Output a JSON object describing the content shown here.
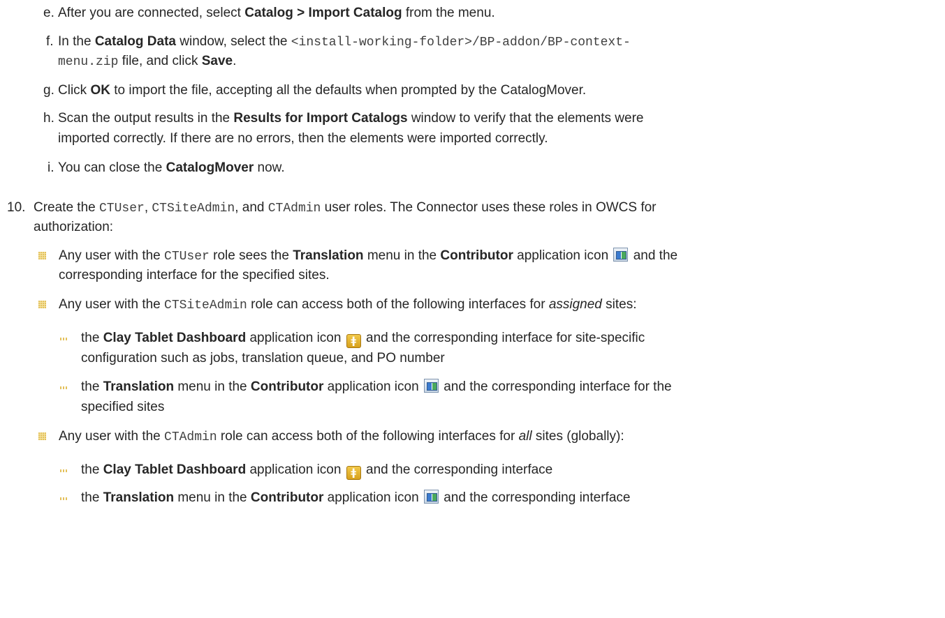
{
  "step_e": {
    "marker": "e.",
    "t1": "After you are connected, select ",
    "b1": "Catalog > Import Catalog",
    "t2": " from the menu."
  },
  "step_f": {
    "marker": "f.",
    "t1": "In the ",
    "b1": "Catalog Data",
    "t2": " window, select the ",
    "code1": "<install-working-folder>/BP-addon/BP-context-",
    "code2": "menu.zip",
    "t3": " file, and click ",
    "b2": "Save",
    "t4": "."
  },
  "step_g": {
    "marker": "g.",
    "t1": "Click ",
    "b1": "OK",
    "t2": " to import the file, accepting all the defaults when prompted by the CatalogMover."
  },
  "step_h": {
    "marker": "h.",
    "t1": "Scan the output results in the ",
    "b1": "Results for Import Catalogs",
    "t2": " window to verify that the elements were",
    "line2": "imported correctly. If there are no errors, then the elements were imported correctly."
  },
  "step_i": {
    "marker": "i.",
    "t1": "You can close the ",
    "b1": "CatalogMover",
    "t2": " now."
  },
  "step_10": {
    "marker": "10.",
    "t1": "Create the ",
    "c1": "CTUser",
    "t2": ", ",
    "c2": "CTSiteAdmin",
    "t3": ", and ",
    "c3": "CTAdmin",
    "t4": " user roles. The Connector uses these roles in OWCS for",
    "line2": "authorization:"
  },
  "bullet_ctuser": {
    "t1": "Any user with the ",
    "c1": "CTUser",
    "t2": " role sees the ",
    "b1": "Translation",
    "t3": " menu in the ",
    "b2": "Contributor",
    "t4": " application icon ",
    "t5": " and the",
    "line2": "corresponding interface for the specified sites."
  },
  "bullet_ctsiteadmin": {
    "t1": "Any user with the ",
    "c1": "CTSiteAdmin",
    "t2": " role can access both of the following interfaces for ",
    "i1": "assigned",
    "t3": " sites:",
    "sub1": {
      "t1": "the ",
      "b1": "Clay Tablet Dashboard",
      "t2": " application icon ",
      "t3": " and the corresponding interface for site-specific",
      "line2": "configuration such as jobs, translation queue, and PO number"
    },
    "sub2": {
      "t1": "the ",
      "b1": "Translation",
      "t2": " menu in the ",
      "b2": "Contributor",
      "t3": " application icon ",
      "t4": " and the corresponding interface for the",
      "line2": "specified sites"
    }
  },
  "bullet_ctadmin": {
    "t1": "Any user with the ",
    "c1": "CTAdmin",
    "t2": " role can access both of the following interfaces for ",
    "i1": "all",
    "t3": " sites (globally):",
    "sub1": {
      "t1": "the ",
      "b1": "Clay Tablet Dashboard",
      "t2": " application icon ",
      "t3": " and the corresponding interface"
    },
    "sub2": {
      "t1": "the ",
      "b1": "Translation",
      "t2": " menu in the ",
      "b2": "Contributor",
      "t3": " application icon ",
      "t4": " and the corresponding interface"
    }
  },
  "icons": {
    "contributor": "contributor-app-icon",
    "clay_tablet": "clay-tablet-dashboard-icon",
    "clay_glyph": "ǂ"
  },
  "colors": {
    "text": "#262626",
    "bullet": "#e4c15c",
    "clay_icon": "#e0aa26",
    "contributor_icon": "#3b7bd0"
  }
}
